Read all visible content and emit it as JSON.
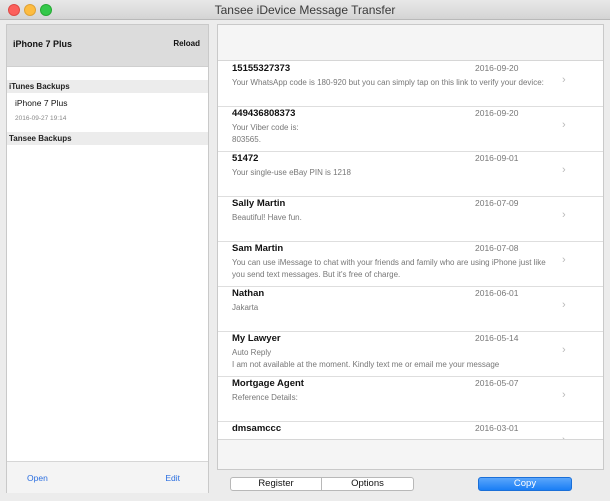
{
  "window": {
    "title": "Tansee iDevice Message Transfer"
  },
  "sidebar": {
    "device": {
      "name": "iPhone 7 Plus",
      "reload_label": "Reload"
    },
    "itunes_section": "iTunes Backups",
    "itunes_backups": [
      {
        "name": "iPhone 7 Plus",
        "date": "2016-09-27 19:14"
      }
    ],
    "tansee_section": "Tansee Backups",
    "open_label": "Open",
    "edit_label": "Edit"
  },
  "messages": [
    {
      "sender": "15155327373",
      "date": "2016-09-20",
      "preview": "Your WhatsApp code is 180-920 but you can simply tap on this link to verify your device:"
    },
    {
      "sender": "449436808373",
      "date": "2016-09-20",
      "preview": "Your Viber code is:\n803565."
    },
    {
      "sender": "51472",
      "date": "2016-09-01",
      "preview": "Your single-use eBay PIN is 1218"
    },
    {
      "sender": "Sally Martin",
      "date": "2016-07-09",
      "preview": "Beautiful! Have fun."
    },
    {
      "sender": "Sam Martin",
      "date": "2016-07-08",
      "preview": "You can use iMessage to chat with your friends and family who are using iPhone just like you send text messages. But it's free of charge."
    },
    {
      "sender": "Nathan",
      "date": "2016-06-01",
      "preview": "Jakarta"
    },
    {
      "sender": "My Lawyer",
      "date": "2016-05-14",
      "preview": "Auto Reply\nI am not available at the moment. Kindly text me or email me your message"
    },
    {
      "sender": "Mortgage Agent",
      "date": "2016-05-07",
      "preview": "Reference Details:"
    },
    {
      "sender": "dmsamccc",
      "date": "2016-03-01",
      "preview": ""
    }
  ],
  "toolbar": {
    "register_label": "Register",
    "options_label": "Options",
    "copy_label": "Copy"
  },
  "icons": {
    "row_chevron": "chevron-right-icon"
  },
  "colors": {
    "accent": "#1a7ef5",
    "link": "#2a6ee0"
  }
}
